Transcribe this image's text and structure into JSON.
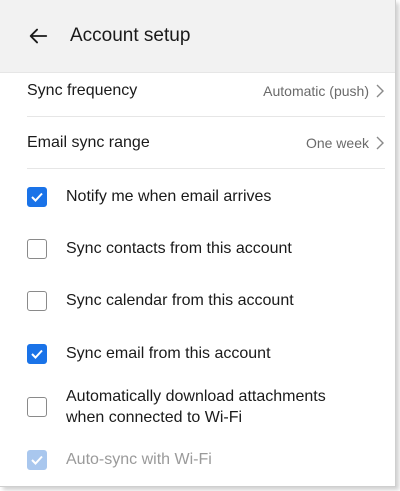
{
  "header": {
    "title": "Account setup",
    "back_icon": "arrow-left-icon"
  },
  "settings": [
    {
      "label": "Sync frequency",
      "value": "Automatic (push)"
    },
    {
      "label": "Email sync range",
      "value": "One week"
    }
  ],
  "checkboxes": [
    {
      "label": "Notify me when email arrives",
      "checked": true
    },
    {
      "label": "Sync contacts from this account",
      "checked": false
    },
    {
      "label": "Sync calendar from this account",
      "checked": false
    },
    {
      "label": "Sync email from this account",
      "checked": true
    },
    {
      "label_line1": "Automatically download attachments",
      "label_line2": "when connected to Wi-Fi",
      "checked": false
    },
    {
      "label": "Auto-sync with Wi-Fi",
      "checked": true,
      "disabled": true
    }
  ],
  "colors": {
    "accent": "#1a73e8",
    "accent_disabled": "#a9c7ee",
    "header_bg": "#f2f2f2"
  }
}
